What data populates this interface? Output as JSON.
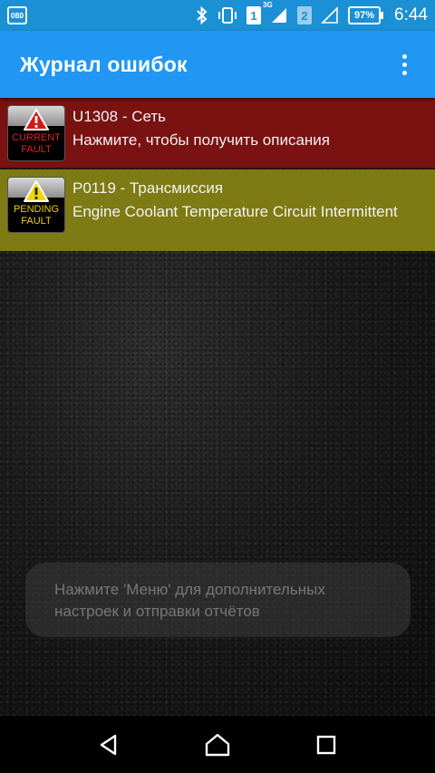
{
  "status_bar": {
    "obd_label": "OBD",
    "network_type": "3G",
    "sim1": "1",
    "sim2": "2",
    "battery": "97%",
    "time": "6:44"
  },
  "app_bar": {
    "title": "Журнал ошибок",
    "overflow_icon": "more-vert-icon"
  },
  "faults": [
    {
      "badge_line1": "CURRENT",
      "badge_line2": "FAULT",
      "code": "U1308 - Сеть",
      "description": "Нажмите, чтобы получить описания",
      "color": "#7a1212"
    },
    {
      "badge_line1": "PENDING",
      "badge_line2": "FAULT",
      "code": "P0119 - Трансмиссия",
      "description": "Engine Coolant Temperature Circuit Intermittent",
      "color": "#7e7a14"
    }
  ],
  "toast": {
    "text": "Нажмите 'Меню' для дополнительных настроек и отправки отчётов"
  },
  "nav_bar": {
    "back_icon": "back-icon",
    "home_icon": "home-icon",
    "recents_icon": "recents-icon"
  },
  "colors": {
    "status_bar": "#1c90d4",
    "app_bar": "#2196f3"
  }
}
